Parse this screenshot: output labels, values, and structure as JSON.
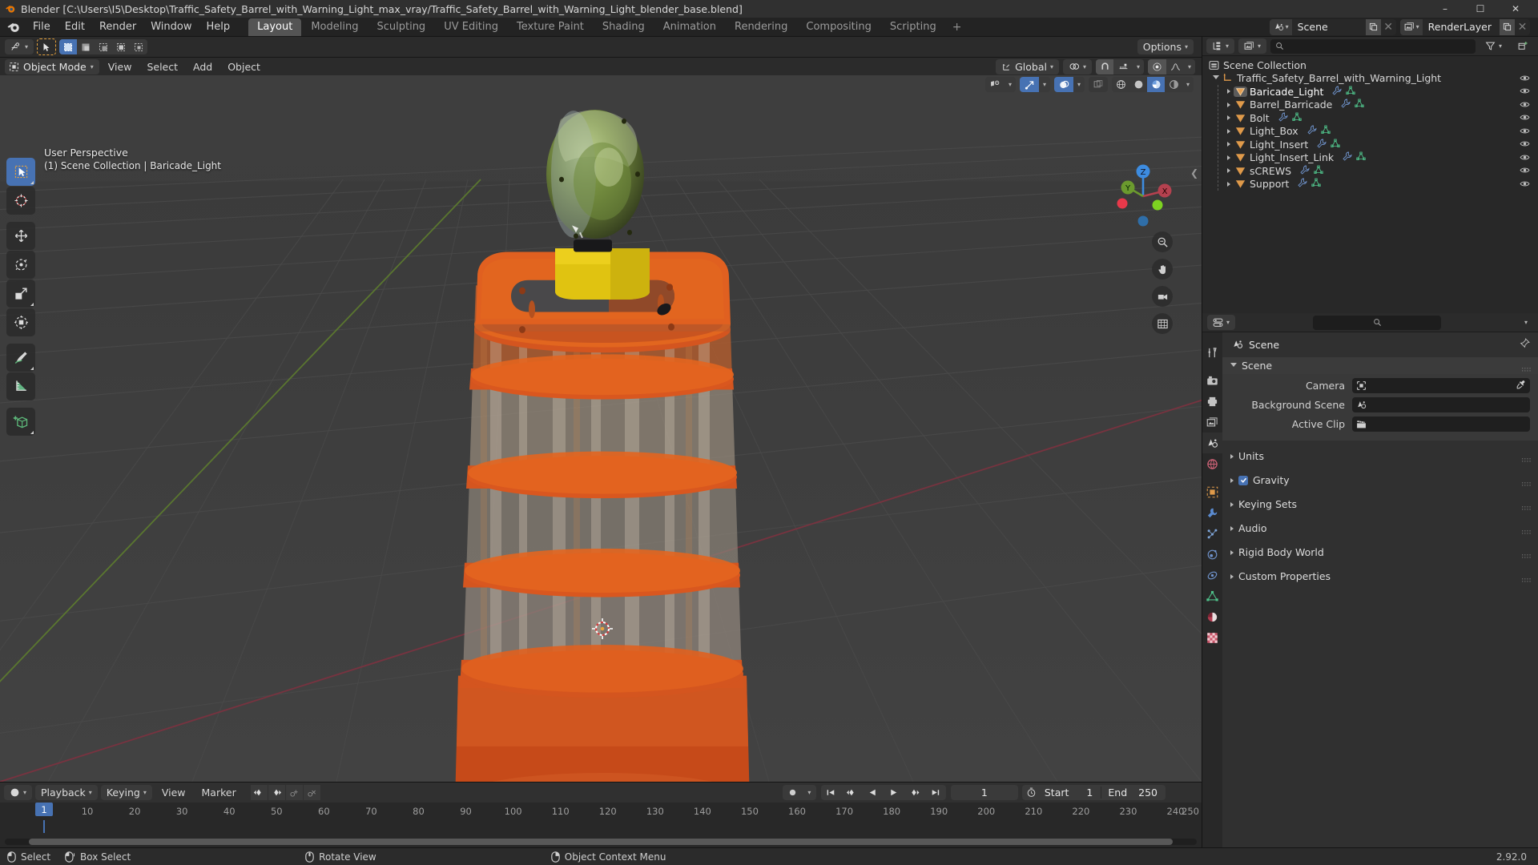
{
  "app": {
    "title": "Blender [C:\\Users\\I5\\Desktop\\Traffic_Safety_Barrel_with_Warning_Light_max_vray/Traffic_Safety_Barrel_with_Warning_Light_blender_base.blend]",
    "version": "2.92.0",
    "accent": "#4772b3",
    "orange": "#e8a33d"
  },
  "window_controls": {
    "minimize": "–",
    "maximize": "☐",
    "close": "✕"
  },
  "menubar": {
    "items": [
      "File",
      "Edit",
      "Render",
      "Window",
      "Help"
    ],
    "workspace_tabs": [
      {
        "label": "Layout",
        "active": true
      },
      {
        "label": "Modeling",
        "active": false
      },
      {
        "label": "Sculpting",
        "active": false
      },
      {
        "label": "UV Editing",
        "active": false
      },
      {
        "label": "Texture Paint",
        "active": false
      },
      {
        "label": "Shading",
        "active": false
      },
      {
        "label": "Animation",
        "active": false
      },
      {
        "label": "Rendering",
        "active": false
      },
      {
        "label": "Compositing",
        "active": false
      },
      {
        "label": "Scripting",
        "active": false
      }
    ],
    "add_tab": "+",
    "scene_name": "Scene",
    "viewlayer_name": "RenderLayer"
  },
  "viewport": {
    "options_label": "Options",
    "mode": "Object Mode",
    "menus": [
      "View",
      "Select",
      "Add",
      "Object"
    ],
    "transform_orientation": "Global",
    "overlay_line1": "User Perspective",
    "overlay_line2": "(1) Scene Collection | Baricade_Light",
    "gizmo_axes": [
      "X",
      "Y",
      "Z"
    ],
    "tools": [
      {
        "name": "tweak-tool",
        "active": true
      },
      {
        "name": "cursor-tool",
        "active": false
      },
      {
        "name": "move-tool",
        "active": false
      },
      {
        "name": "rotate-tool",
        "active": false
      },
      {
        "name": "scale-tool",
        "active": false
      },
      {
        "name": "transform-tool",
        "active": false
      },
      {
        "name": "annotate-tool",
        "active": false
      },
      {
        "name": "measure-tool",
        "active": false
      },
      {
        "name": "add-cube-tool",
        "active": false
      }
    ]
  },
  "outliner": {
    "root": "Scene Collection",
    "collection": "Traffic_Safety_Barrel_with_Warning_Light",
    "objects": [
      {
        "name": "Baricade_Light",
        "selected": true
      },
      {
        "name": "Barrel_Barricade",
        "selected": false
      },
      {
        "name": "Bolt",
        "selected": false
      },
      {
        "name": "Light_Box",
        "selected": false
      },
      {
        "name": "Light_Insert",
        "selected": false
      },
      {
        "name": "Light_Insert_Link",
        "selected": false
      },
      {
        "name": "sCREWS",
        "selected": false
      },
      {
        "name": "Support",
        "selected": false
      }
    ]
  },
  "properties": {
    "breadcrumb": "Scene",
    "tabs": [
      {
        "name": "tool-tab",
        "active": false
      },
      {
        "name": "render-tab",
        "active": false
      },
      {
        "name": "output-tab",
        "active": false
      },
      {
        "name": "viewlayer-tab",
        "active": false
      },
      {
        "name": "scene-tab",
        "active": true
      },
      {
        "name": "world-tab",
        "active": false
      },
      {
        "name": "object-tab",
        "active": false
      },
      {
        "name": "modifier-tab",
        "active": false
      },
      {
        "name": "particles-tab",
        "active": false
      },
      {
        "name": "physics-tab",
        "active": false
      },
      {
        "name": "constraints-tab",
        "active": false
      },
      {
        "name": "data-tab",
        "active": false
      },
      {
        "name": "material-tab",
        "active": false
      },
      {
        "name": "texture-tab",
        "active": false
      }
    ],
    "panels": [
      {
        "label": "Scene",
        "open": true
      },
      {
        "label": "Units",
        "open": false
      },
      {
        "label": "Gravity",
        "open": false,
        "checkbox": true
      },
      {
        "label": "Keying Sets",
        "open": false
      },
      {
        "label": "Audio",
        "open": false
      },
      {
        "label": "Rigid Body World",
        "open": false
      },
      {
        "label": "Custom Properties",
        "open": false
      }
    ],
    "scene_fields": [
      {
        "label": "Camera",
        "value": "",
        "icon": "camera-icon"
      },
      {
        "label": "Background Scene",
        "value": "",
        "icon": "scene-icon"
      },
      {
        "label": "Active Clip",
        "value": "",
        "icon": "clip-icon"
      }
    ]
  },
  "timeline": {
    "menus": [
      "Playback",
      "Keying",
      "View",
      "Marker"
    ],
    "current_frame": "1",
    "start_label": "Start",
    "start_value": "1",
    "end_label": "End",
    "end_value": "250",
    "ticks": [
      "1",
      "10",
      "20",
      "30",
      "40",
      "50",
      "60",
      "70",
      "80",
      "90",
      "100",
      "110",
      "120",
      "130",
      "140",
      "150",
      "160",
      "170",
      "180",
      "190",
      "200",
      "210",
      "220",
      "230",
      "240",
      "250"
    ],
    "playhead_frame": 1
  },
  "statusbar": {
    "items": [
      {
        "icon": "mouse-left-icon",
        "label": "Select"
      },
      {
        "icon": "mouse-drag-icon",
        "label": "Box Select"
      },
      {
        "icon": "mouse-middle-icon",
        "label": "Rotate View"
      },
      {
        "icon": "mouse-right-icon",
        "label": "Object Context Menu"
      }
    ],
    "version": "2.92.0"
  }
}
